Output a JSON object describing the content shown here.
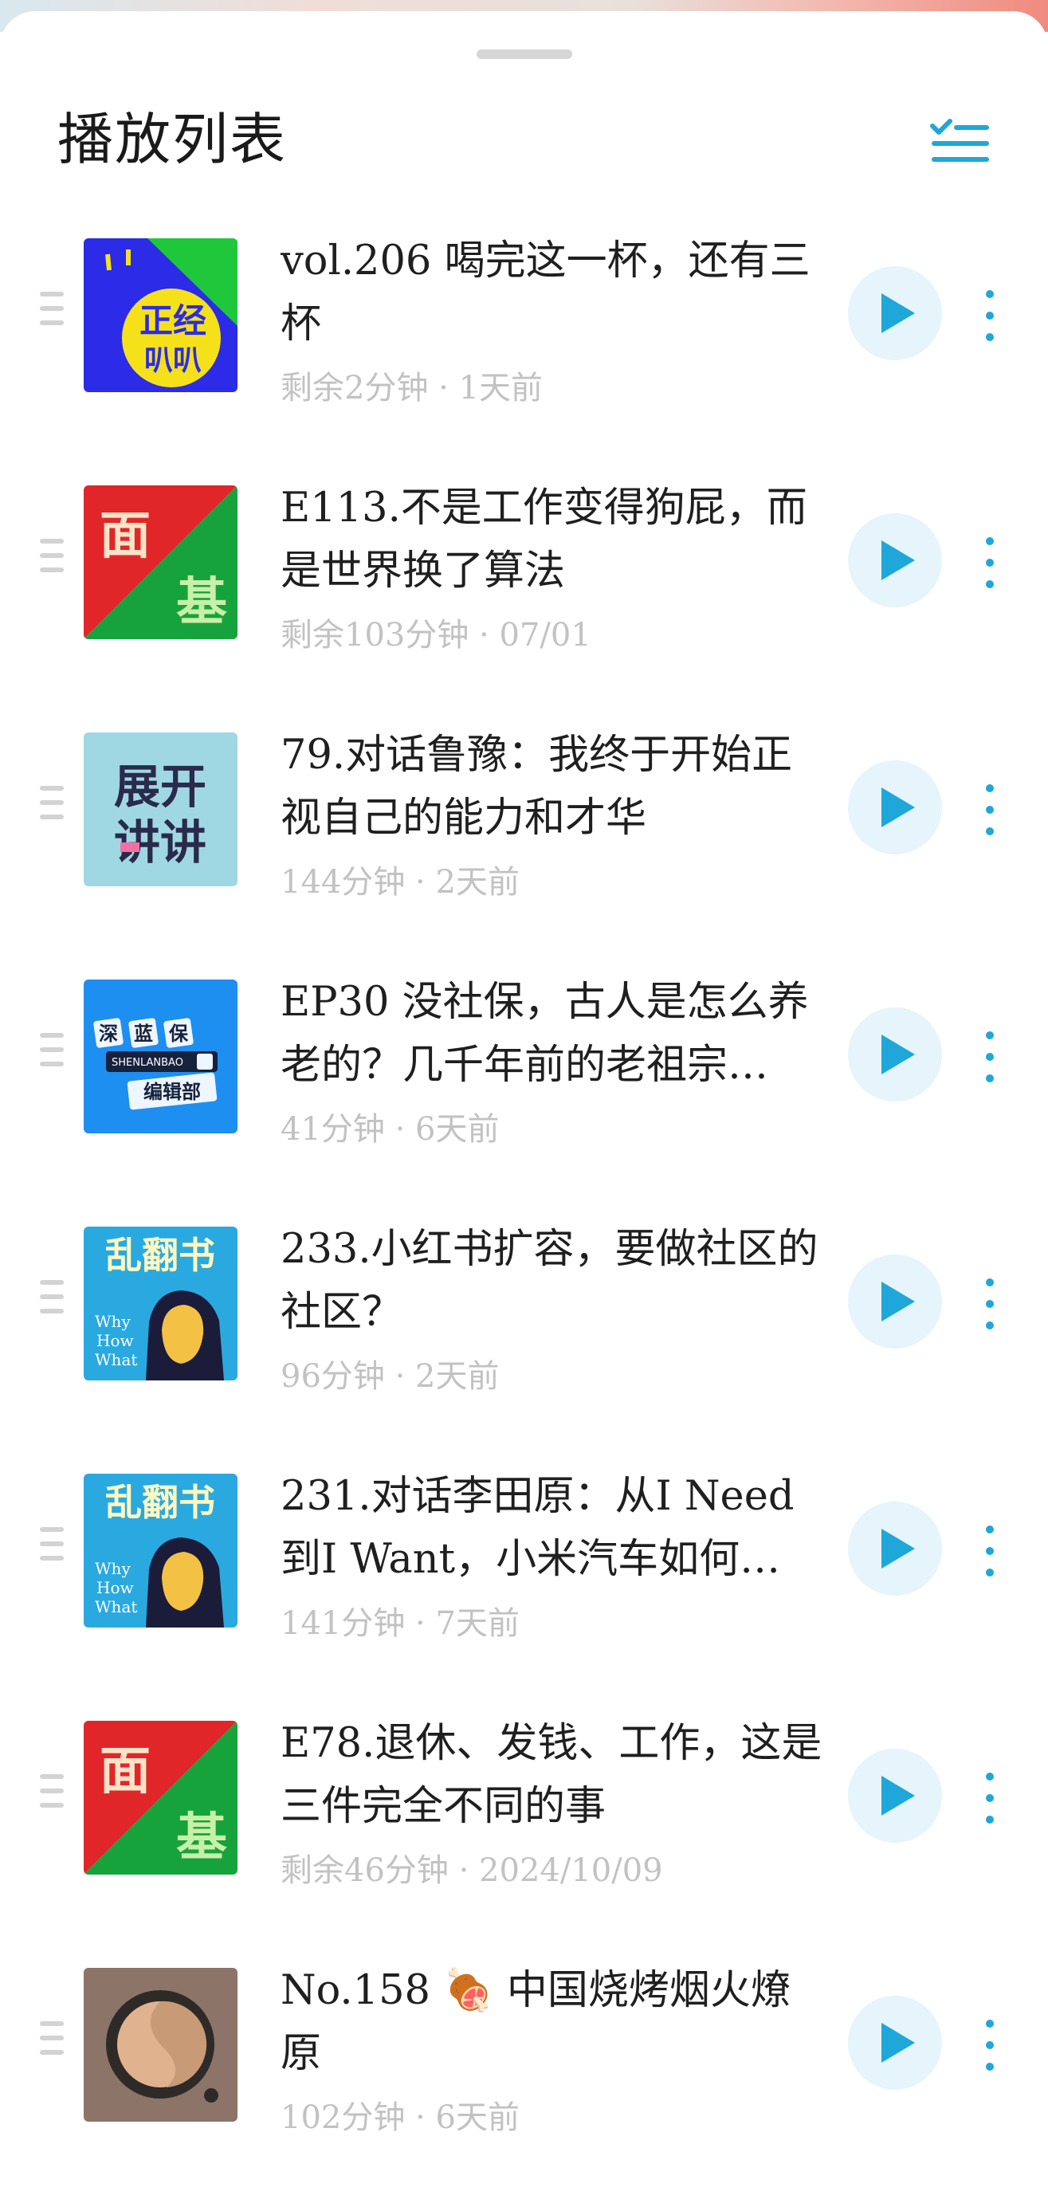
{
  "header": {
    "title": "播放列表"
  },
  "colors": {
    "accent": "#1ea7d8",
    "play_bg": "#e6f4fb",
    "meta": "#c2c2c2"
  },
  "icons": {
    "queue": "playlist-check-icon",
    "play": "play-icon",
    "more": "more-vertical-icon",
    "drag": "drag-handle-icon"
  },
  "episodes": [
    {
      "title": "vol.206 喝完这一杯，还有三杯",
      "meta": "剩余2分钟 · 1天前",
      "cover": "zhengjing-baba"
    },
    {
      "title": "E113.不是工作变得狗屁，而是世界换了算法",
      "meta": "剩余103分钟 · 07/01",
      "cover": "mianji"
    },
    {
      "title": "79.对话鲁豫：我终于开始正视自己的能力和才华",
      "meta": "144分钟 · 2天前",
      "cover": "zhankai-jiangjiang"
    },
    {
      "title": "EP30 没社保，古人是怎么养老的？几千年前的老祖宗…",
      "meta": "41分钟 · 6天前",
      "cover": "shenlanbao"
    },
    {
      "title": "233.小红书扩容，要做社区的社区？",
      "meta": "96分钟 · 2天前",
      "cover": "luanfanshu"
    },
    {
      "title": "231.对话李田原：从I Need到I Want，小米汽车如何…",
      "meta": "141分钟 · 7天前",
      "cover": "luanfanshu"
    },
    {
      "title": "E78.退休、发钱、工作，这是三件完全不同的事",
      "meta": "剩余46分钟 · 2024/10/09",
      "cover": "mianji"
    },
    {
      "title": "No.158 🍖 中国烧烤烟火燎原",
      "meta": "102分钟 · 6天前",
      "cover": "ring-logo"
    }
  ],
  "cover_text": {
    "zhengjing": "正经",
    "baba": "叭叭",
    "mian": "面",
    "ji": "基",
    "zhankai": "展开",
    "jiangjiang": "讲讲",
    "shen_lan_bao": [
      "深",
      "蓝",
      "保"
    ],
    "shenlanbao_en": "SHENLANBAO",
    "bianjibu": "编辑部",
    "luanfanshu": "乱翻书",
    "why": "Why",
    "how": "How",
    "what": "What"
  }
}
